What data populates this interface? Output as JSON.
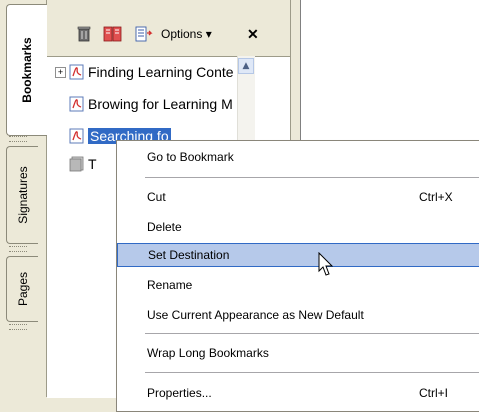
{
  "tabs": [
    {
      "label": "Bookmarks",
      "active": true
    },
    {
      "label": "Signatures",
      "active": false
    },
    {
      "label": "Pages",
      "active": false
    }
  ],
  "toolbar": {
    "delete_icon": "trash-icon",
    "new_bookmark_icon": "new-bookmark-icon",
    "expand_icon": "expand-bookmark-icon",
    "options_label": "Options ▾",
    "close_label": "✕"
  },
  "bookmarks": [
    {
      "label": "Finding Learning Conte",
      "expandable": true
    },
    {
      "label": "Browing for Learning M",
      "expandable": false
    },
    {
      "label": "Searching fo",
      "expandable": false,
      "selected": true
    },
    {
      "label": "T",
      "expandable": false
    }
  ],
  "menu": {
    "go_to": "Go to Bookmark",
    "cut": "Cut",
    "cut_sc": "Ctrl+X",
    "delete": "Delete",
    "set_destination": "Set Destination",
    "rename": "Rename",
    "use_current": "Use Current Appearance as New Default",
    "wrap": "Wrap Long Bookmarks",
    "properties": "Properties...",
    "properties_sc": "Ctrl+I"
  },
  "colors": {
    "accent": "#316ac5",
    "highlight": "#b6c9ea",
    "pdf_red": "#d32f2f"
  }
}
